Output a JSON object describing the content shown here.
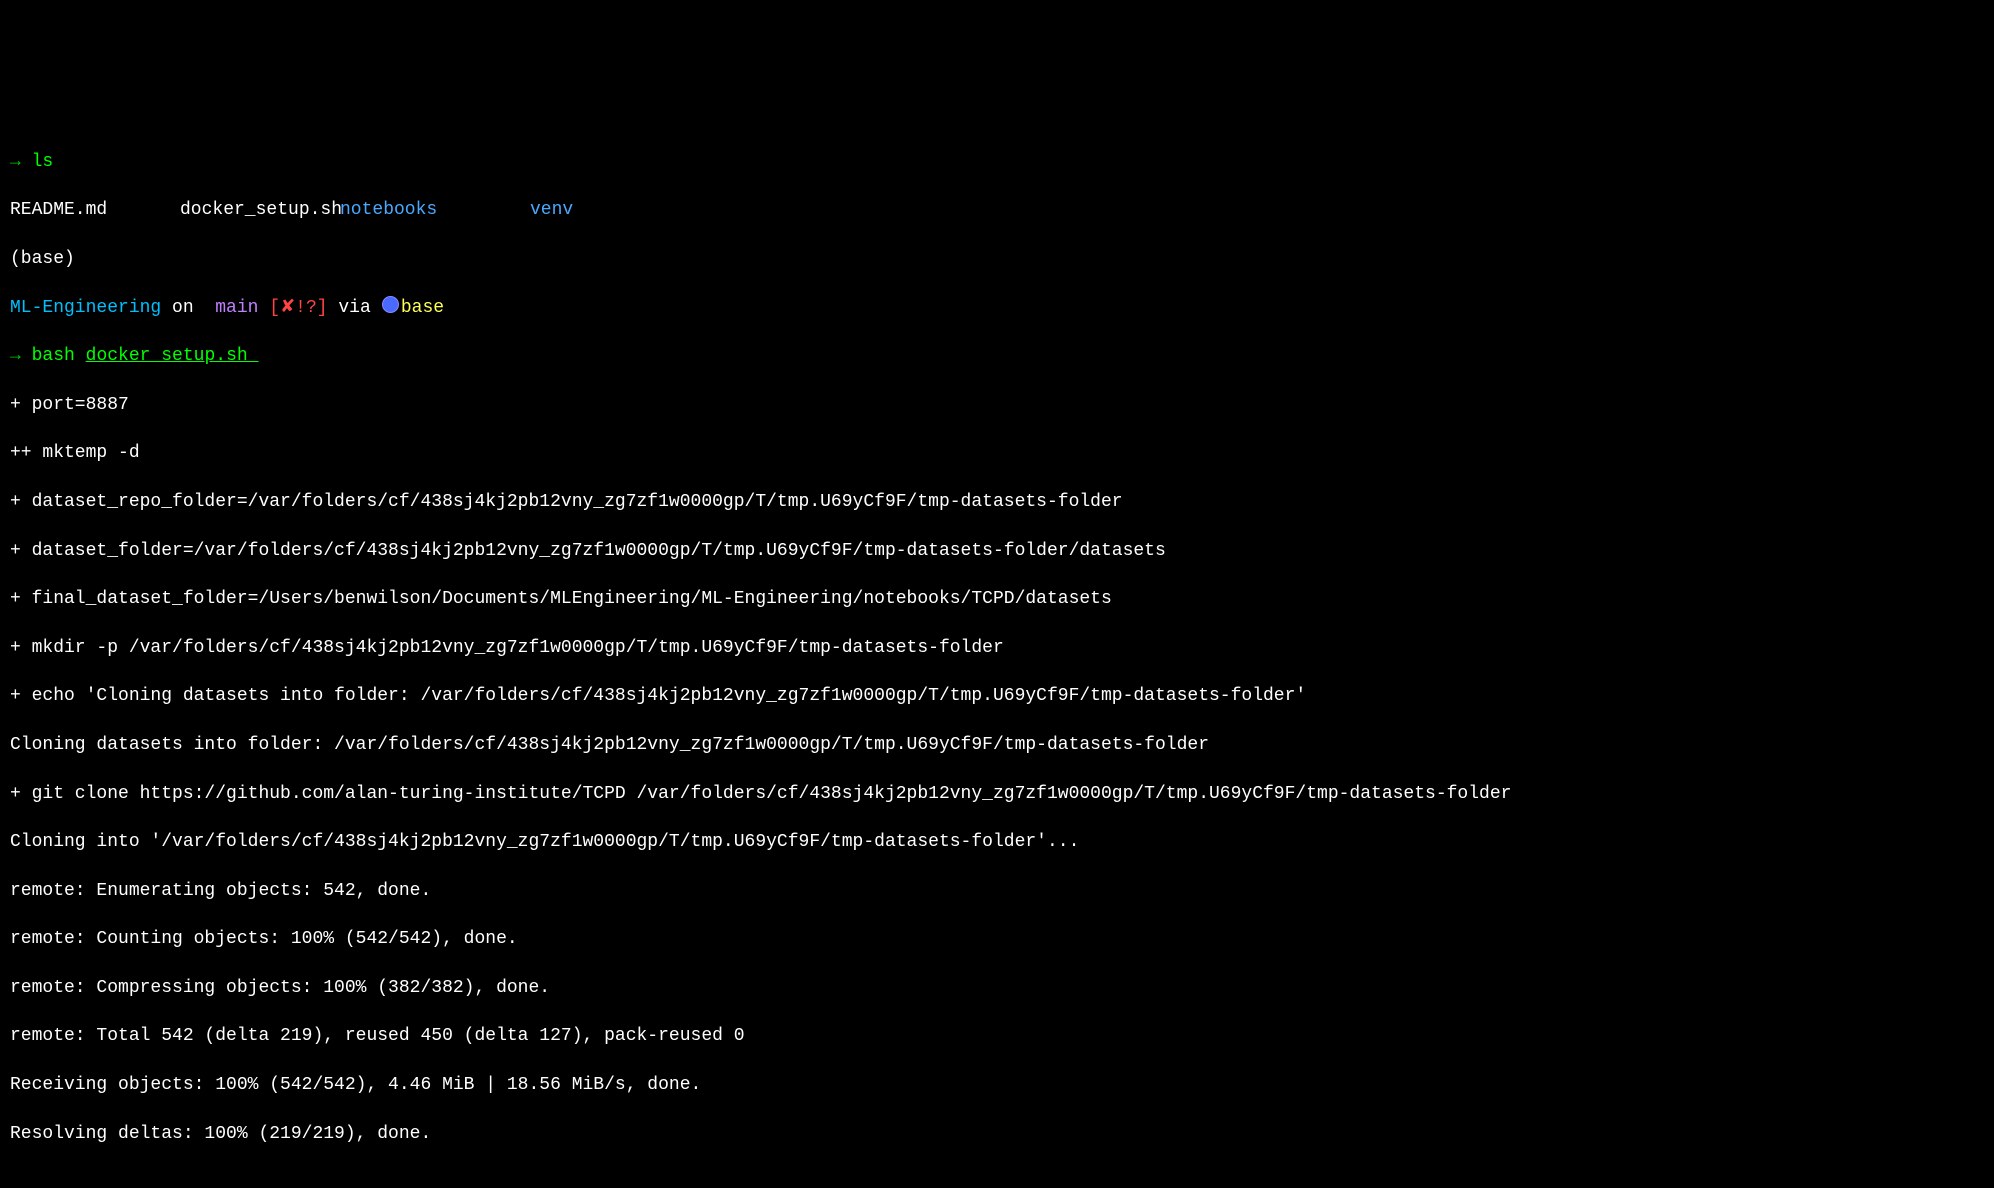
{
  "prompt1": {
    "arrow": "→",
    "cmd": "ls"
  },
  "ls_output": {
    "col0": "README.md",
    "col1": "docker_setup.sh",
    "col2": "notebooks",
    "col3": "venv"
  },
  "base_env": "(base)",
  "prompt2": {
    "repo": "ML-Engineering",
    "on": " on ",
    "branch_symbol": "",
    "branch": " main ",
    "status": "[✘!?]",
    "via": " via ",
    "env_label": "base"
  },
  "prompt3": {
    "arrow": "→",
    "cmd": "bash ",
    "arg": "docker_setup.sh "
  },
  "trace": [
    "+ port=8887",
    "++ mktemp -d",
    "+ dataset_repo_folder=/var/folders/cf/438sj4kj2pb12vny_zg7zf1w0000gp/T/tmp.U69yCf9F/tmp-datasets-folder",
    "+ dataset_folder=/var/folders/cf/438sj4kj2pb12vny_zg7zf1w0000gp/T/tmp.U69yCf9F/tmp-datasets-folder/datasets",
    "+ final_dataset_folder=/Users/benwilson/Documents/MLEngineering/ML-Engineering/notebooks/TCPD/datasets",
    "+ mkdir -p /var/folders/cf/438sj4kj2pb12vny_zg7zf1w0000gp/T/tmp.U69yCf9F/tmp-datasets-folder",
    "+ echo 'Cloning datasets into folder: /var/folders/cf/438sj4kj2pb12vny_zg7zf1w0000gp/T/tmp.U69yCf9F/tmp-datasets-folder'",
    "Cloning datasets into folder: /var/folders/cf/438sj4kj2pb12vny_zg7zf1w0000gp/T/tmp.U69yCf9F/tmp-datasets-folder",
    "+ git clone https://github.com/alan-turing-institute/TCPD /var/folders/cf/438sj4kj2pb12vny_zg7zf1w0000gp/T/tmp.U69yCf9F/tmp-datasets-folder",
    "Cloning into '/var/folders/cf/438sj4kj2pb12vny_zg7zf1w0000gp/T/tmp.U69yCf9F/tmp-datasets-folder'...",
    "remote: Enumerating objects: 542, done.",
    "remote: Counting objects: 100% (542/542), done.",
    "remote: Compressing objects: 100% (382/382), done.",
    "remote: Total 542 (delta 219), reused 450 (delta 127), pack-reused 0",
    "Receiving objects: 100% (542/542), 4.46 MiB | 18.56 MiB/s, done.",
    "Resolving deltas: 100% (219/219), done."
  ]
}
